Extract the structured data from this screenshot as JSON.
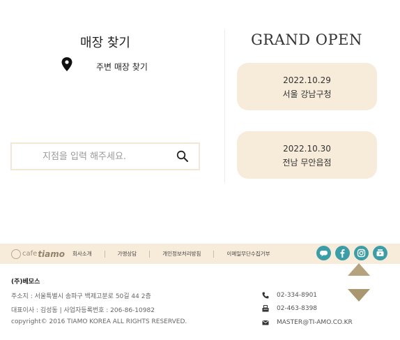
{
  "store_finder": {
    "title": "매장 찾기",
    "nearby_label": "주변 매장 찾기",
    "search_placeholder": "지점을 입력 해주세요."
  },
  "grand_open": {
    "title": "GRAND OPEN",
    "events": [
      {
        "date": "2022.10.29",
        "place": "서울 강남구청"
      },
      {
        "date": "2022.10.30",
        "place": "전남 무안읍점"
      }
    ]
  },
  "footer": {
    "logo": {
      "cafe": "cafe",
      "brand": "tiamo"
    },
    "nav": [
      "회사소개",
      "가맹상담",
      "개인정보처리방침",
      "이메일무단수집거부"
    ],
    "social": [
      "talk-icon",
      "facebook-icon",
      "instagram-icon",
      "youtube-icon"
    ],
    "company": "(주)베모스",
    "address": "주소지 : 서울특별시 송파구 백제고분로 50길 44 2층",
    "ceo": "대표이사 : 김성동 | 사업자등록번호 : 206-86-10982",
    "copyright": "copyright© 2016 TIAMO KOREA ALL RIGHTS RESERVED.",
    "contacts": {
      "phone": "02-334-8901",
      "fax": "02-463-8398",
      "email": "MASTER@TI-AMO.CO.KR"
    }
  },
  "colors": {
    "cream": "#f7ebda",
    "accent_teal": "#3a9ea8",
    "arrow_tan": "#b5a37e"
  }
}
